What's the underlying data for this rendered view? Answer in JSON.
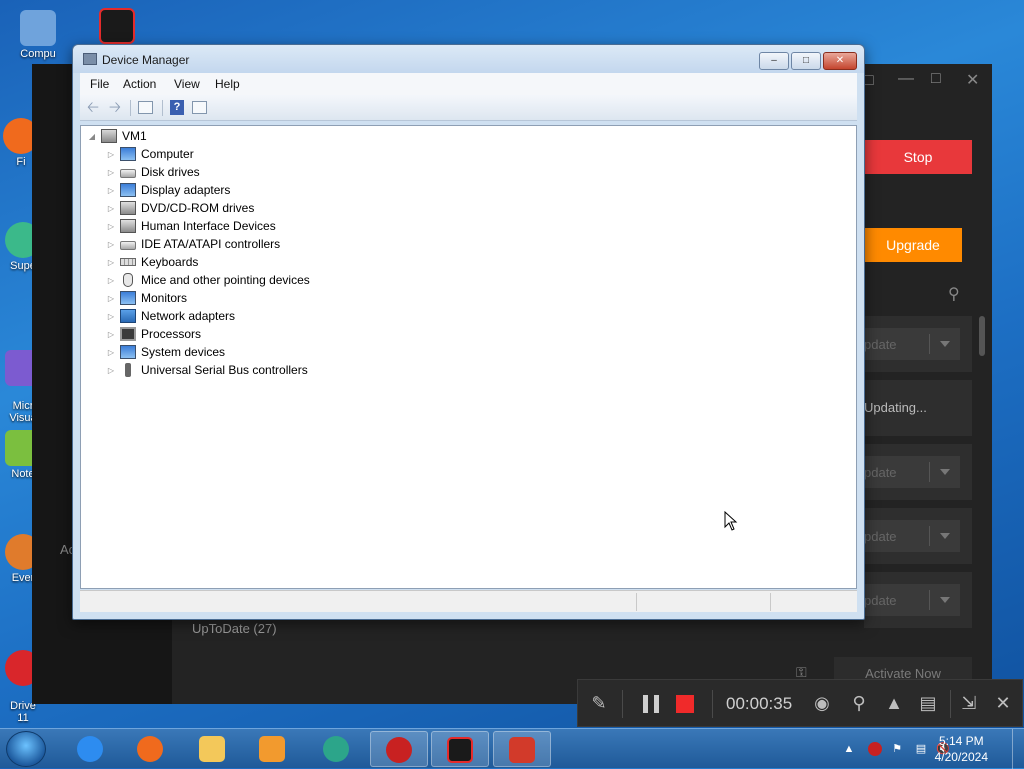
{
  "desktop": {
    "icons": [
      {
        "label": "Compu",
        "icon": "computer-icon",
        "color": "#6fa3dc"
      },
      {
        "label": "Fi",
        "icon": "firefox-icon",
        "color": "#f06a1d"
      },
      {
        "label": "Supe",
        "icon": "app-icon",
        "color": "#3bb98a"
      },
      {
        "label": "Micr\nVisua",
        "icon": "visual-studio-icon",
        "color": "#7c5bd0"
      },
      {
        "label": "Note",
        "icon": "notepad-icon",
        "color": "#7bbf3f"
      },
      {
        "label": "Ever",
        "icon": "app-icon",
        "color": "#e07b2c"
      },
      {
        "label": "Drive\n11",
        "icon": "driver-booster-icon",
        "color": "#d9262b"
      }
    ],
    "top_app_icon": "screen-recorder-icon"
  },
  "background_app": {
    "stop_label": "Stop",
    "upgrade_label": "Upgrade",
    "update_label": "pdate",
    "updating_label": "Updating...",
    "uptodate_label": "UpToDate (27)",
    "activate_label": "Activate Now",
    "left_partial_text": "Ac",
    "colors": {
      "stop": "#e8383b",
      "upgrade": "#ff8a00"
    }
  },
  "device_manager": {
    "title": "Device Manager",
    "menu": [
      "File",
      "Action",
      "View",
      "Help"
    ],
    "root": "VM1",
    "categories": [
      {
        "label": "Computer",
        "icon": "computer-icon"
      },
      {
        "label": "Disk drives",
        "icon": "disk-drive-icon"
      },
      {
        "label": "Display adapters",
        "icon": "display-adapter-icon"
      },
      {
        "label": "DVD/CD-ROM drives",
        "icon": "dvd-drive-icon"
      },
      {
        "label": "Human Interface Devices",
        "icon": "hid-icon"
      },
      {
        "label": "IDE ATA/ATAPI controllers",
        "icon": "ide-controller-icon"
      },
      {
        "label": "Keyboards",
        "icon": "keyboard-icon"
      },
      {
        "label": "Mice and other pointing devices",
        "icon": "mouse-icon"
      },
      {
        "label": "Monitors",
        "icon": "monitor-icon"
      },
      {
        "label": "Network adapters",
        "icon": "network-adapter-icon"
      },
      {
        "label": "Processors",
        "icon": "processor-icon"
      },
      {
        "label": "System devices",
        "icon": "system-devices-icon"
      },
      {
        "label": "Universal Serial Bus controllers",
        "icon": "usb-icon"
      }
    ]
  },
  "recorder": {
    "time": "00:00:35",
    "stop_color": "#f02a2a"
  },
  "taskbar": {
    "apps": [
      "internet-explorer-icon",
      "firefox-icon",
      "file-explorer-icon",
      "media-player-icon",
      "edge-icon",
      "driver-booster-icon",
      "screen-recorder-icon",
      "toolbox-icon"
    ],
    "clock_time": "5:14 PM",
    "clock_date": "4/20/2024"
  }
}
